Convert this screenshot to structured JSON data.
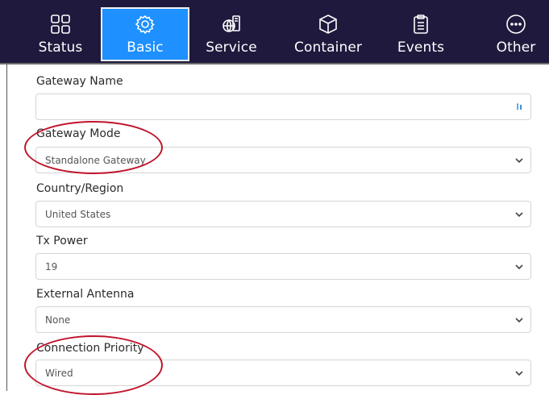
{
  "nav": {
    "tabs": [
      {
        "label": "Status",
        "icon": "grid-icon",
        "active": false
      },
      {
        "label": "Basic",
        "icon": "gear-icon",
        "active": true
      },
      {
        "label": "Service",
        "icon": "globe-service-icon",
        "active": false
      },
      {
        "label": "Container",
        "icon": "cube-icon",
        "active": false
      },
      {
        "label": "Events",
        "icon": "clipboard-icon",
        "active": false
      },
      {
        "label": "Other",
        "icon": "more-icon",
        "active": false
      }
    ],
    "bg_color": "#1f1a3d",
    "active_color": "#1e90ff"
  },
  "form": {
    "gateway_name": {
      "label": "Gateway Name",
      "value": ""
    },
    "gateway_mode": {
      "label": "Gateway Mode",
      "value": "Standalone Gateway"
    },
    "country_region": {
      "label": "Country/Region",
      "value": "United States"
    },
    "tx_power": {
      "label": "Tx Power",
      "value": "19"
    },
    "external_antenna": {
      "label": "External Antenna",
      "value": "None"
    },
    "connection_priority": {
      "label": "Connection Priority",
      "value": "Wired"
    }
  },
  "annotation_color": "#c0142b"
}
